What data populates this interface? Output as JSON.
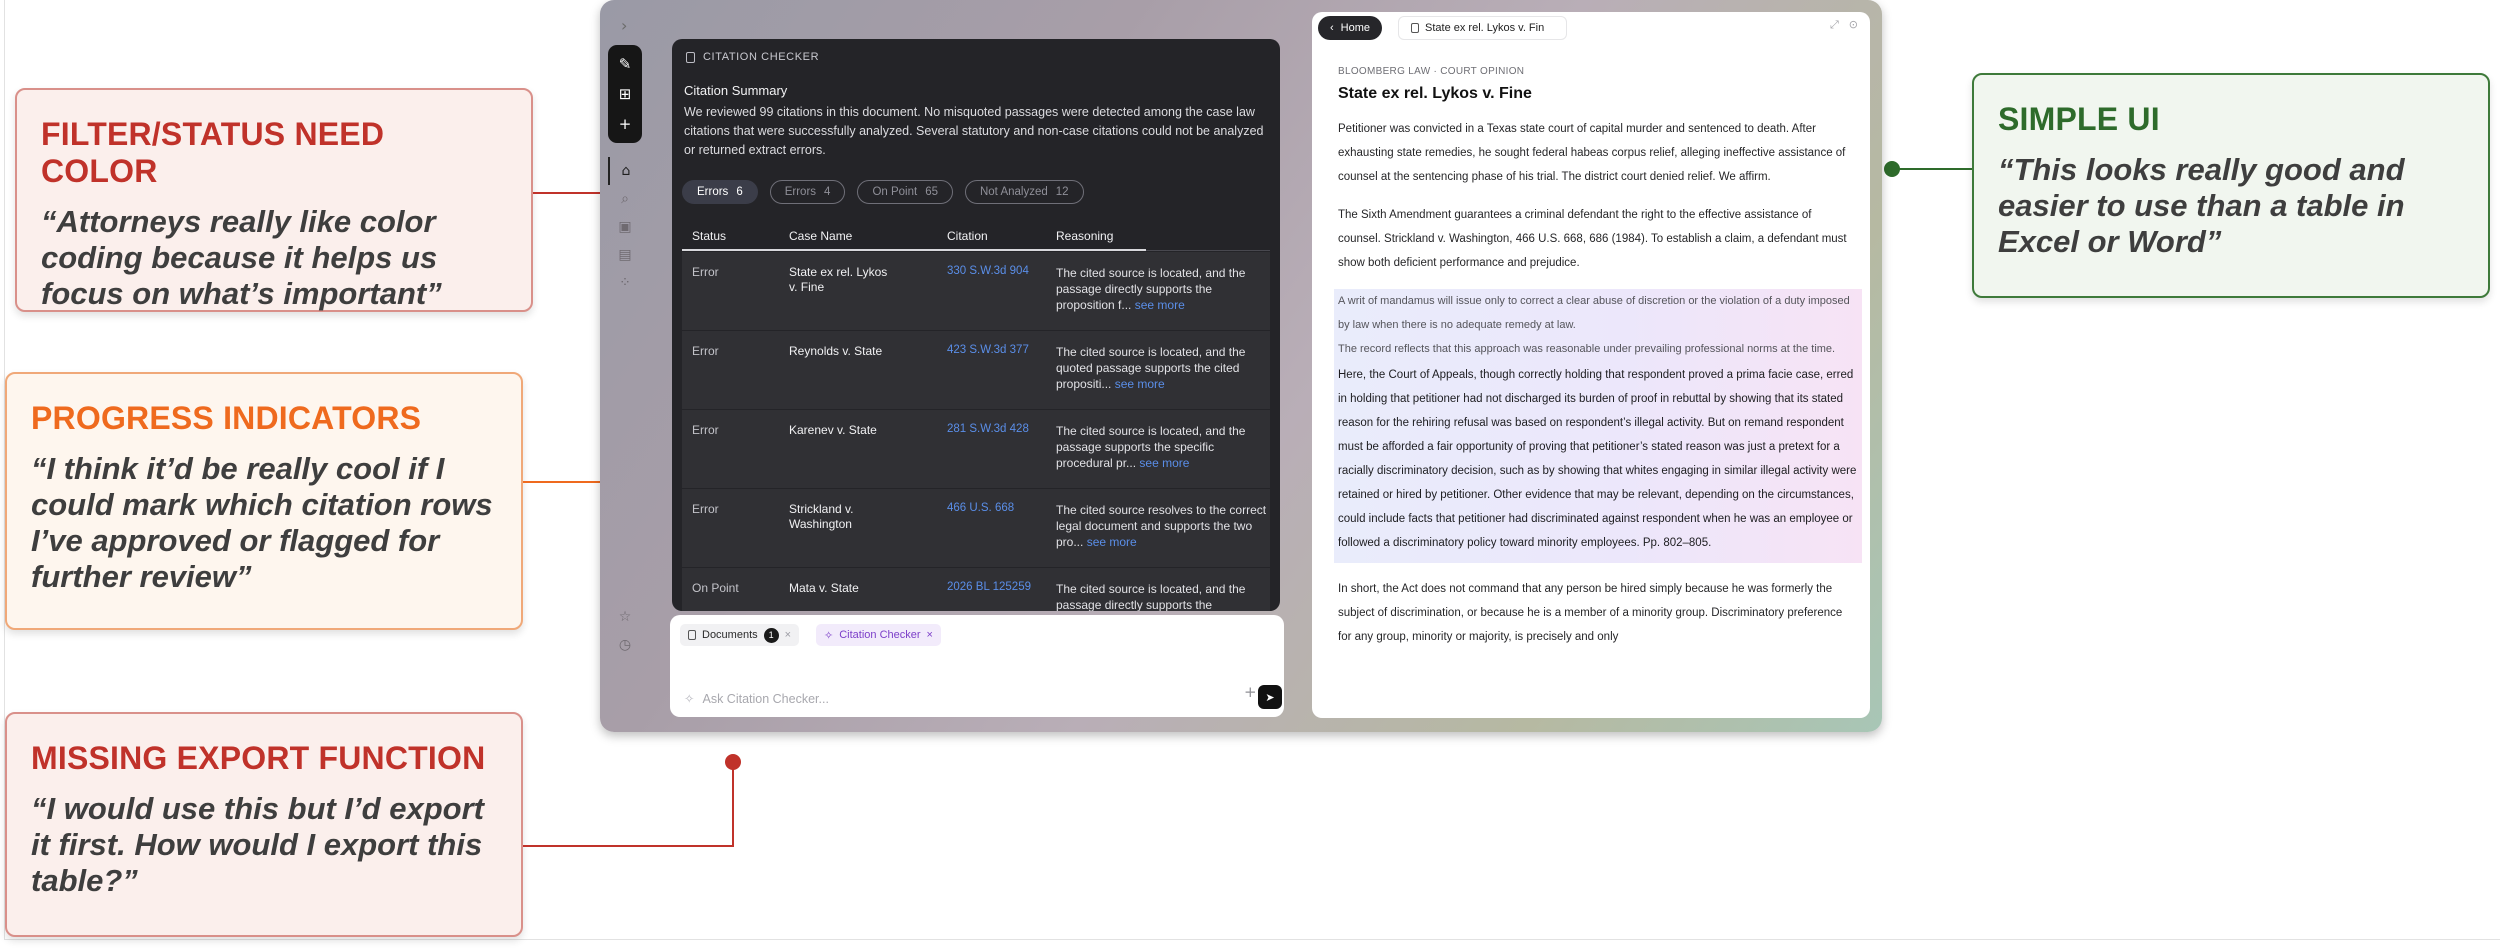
{
  "annotations": {
    "filter_status": {
      "title": "FILTER/STATUS NEED COLOR",
      "quote": "“Attorneys really like color coding because it helps us focus on what’s important”"
    },
    "progress": {
      "title": "PROGRESS INDICATORS",
      "quote": "“I think it’d be really cool if I could mark which citation rows I’ve approved or flagged for further review”"
    },
    "export": {
      "title": "MISSING EXPORT FUNCTION",
      "quote": "“I would use this but I’d export it first. How would I export this table?”"
    },
    "simple_ui": {
      "title": "SIMPLE UI",
      "quote": "“This looks really good and easier to use than a table in Excel or Word”"
    }
  },
  "colors": {
    "red": "#c0322a",
    "orange": "#ef6a1e",
    "green": "#2e6b2b",
    "link_blue": "#5a8ee8",
    "checker_purple": "#7c3fc9"
  },
  "rail": {
    "icons": [
      "new-chat-icon",
      "grid-icon",
      "plus-icon",
      "home-icon",
      "search-icon",
      "briefcase-icon",
      "library-icon",
      "apps-icon",
      "star-icon",
      "history-icon"
    ]
  },
  "citation_checker": {
    "header": "CITATION CHECKER",
    "summary_title": "Citation Summary",
    "summary_text": "We reviewed 99 citations in this document. No misquoted passages were detected among the case law citations that were successfully analyzed. Several statutory and non-case citations could not be analyzed or returned extract errors.",
    "filters": [
      {
        "label": "Errors",
        "count": "6"
      },
      {
        "label": "Errors",
        "count": "4"
      },
      {
        "label": "On Point",
        "count": "65"
      },
      {
        "label": "Not Analyzed",
        "count": "12"
      }
    ],
    "columns": {
      "status": "Status",
      "case_name": "Case Name",
      "citation": "Citation",
      "reasoning": "Reasoning"
    },
    "see_more": "see more",
    "rows": [
      {
        "status": "Error",
        "case_name": "State ex rel. Lykos v. Fine",
        "citation": "330 S.W.3d 904",
        "reasoning": "The cited source is located, and the passage directly supports the proposition f..."
      },
      {
        "status": "Error",
        "case_name": "Reynolds v. State",
        "citation": "423 S.W.3d 377",
        "reasoning": "The cited source is located, and the quoted passage supports the cited propositi..."
      },
      {
        "status": "Error",
        "case_name": "Karenev v. State",
        "citation": "281 S.W.3d 428",
        "reasoning": "The cited source is located, and the passage supports the specific procedural pr..."
      },
      {
        "status": "Error",
        "case_name": "Strickland v. Washington",
        "citation": "466 U.S. 668",
        "reasoning": "The cited source resolves to the correct legal document and supports the two pro..."
      },
      {
        "status": "On Point",
        "case_name": "Mata v. State",
        "citation": "2026 BL 125259",
        "reasoning": "The cited source is located, and the passage directly supports the"
      }
    ]
  },
  "chat": {
    "chip_documents": "Documents",
    "chip_documents_count": "1",
    "chip_checker": "Citation Checker",
    "placeholder": "Ask Citation Checker..."
  },
  "document": {
    "home_label": "Home",
    "tab_title": "State ex rel. Lykos v. Fin",
    "eyebrow": "BLOOMBERG LAW · COURT OPINION",
    "title": "State ex rel. Lykos v. Fine",
    "para1": "Petitioner was convicted in a Texas state court of capital murder and sentenced to death. After exhausting state remedies, he sought federal habeas corpus relief, alleging ineffective assistance of counsel at the sentencing phase of his trial. The district court denied relief. We affirm.",
    "para2": "The Sixth Amendment guarantees a criminal defendant the right to the effective assistance of counsel. Strickland v. Washington, 466 U.S. 668, 686 (1984). To establish a claim, a defendant must show both deficient performance and prejudice.",
    "hl_line1": "A writ of mandamus will issue only to correct a clear abuse of discretion or the violation of a duty imposed by law when there is no adequate remedy at law.",
    "hl_line2": "The record reflects that this approach was reasonable under prevailing professional norms at the time.",
    "hl_para": "Here, the Court of Appeals, though correctly holding that respondent proved a prima facie case, erred in holding that petitioner had not discharged its burden of proof in rebuttal by showing that its stated reason for the rehiring refusal was based on respondent’s illegal activity. But on remand respondent must be afforded a fair opportunity of proving that petitioner’s stated reason was just a pretext for a racially discriminatory decision, such as by showing that whites engaging in similar illegal activity were retained or hired by petitioner. Other evidence that may be relevant, depending on the circumstances, could include facts that petitioner had discriminated against respondent when he was an employee or followed a discriminatory policy toward minority employees. Pp. 802–805.",
    "para3": "In short, the Act does not command that any person be hired simply because he was formerly the subject of discrimination, or because he is a member of a minority group. Discriminatory preference for any group, minority or majority, is precisely and only"
  }
}
